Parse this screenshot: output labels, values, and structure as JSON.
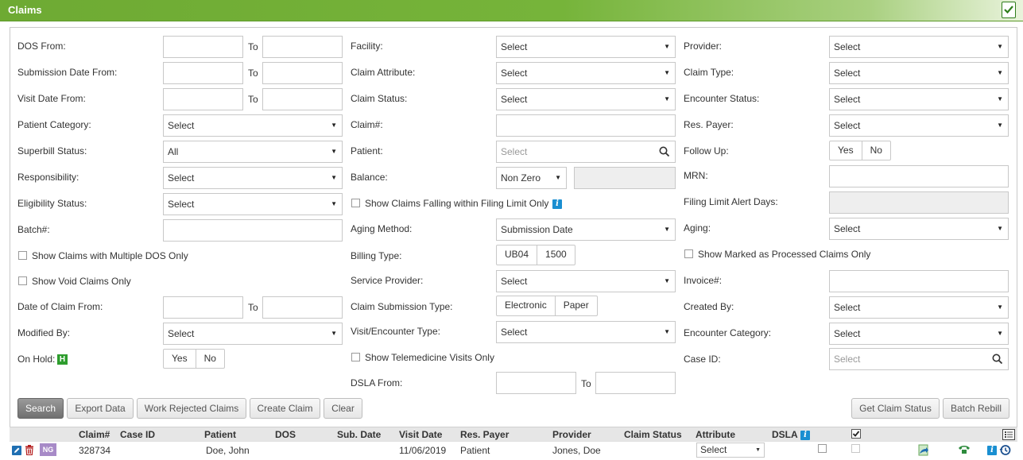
{
  "header": {
    "title": "Claims",
    "icon": "clipboard-check-icon"
  },
  "labels": {
    "dos_from": "DOS From:",
    "to": "To",
    "submission_date_from": "Submission Date From:",
    "visit_date_from": "Visit Date From:",
    "patient_category": "Patient Category:",
    "superbill_status": "Superbill Status:",
    "responsibility": "Responsibility:",
    "eligibility_status": "Eligibility Status:",
    "batch": "Batch#:",
    "show_multiple_dos": "Show Claims with Multiple DOS Only",
    "show_void": "Show Void Claims Only",
    "date_of_claim_from": "Date of Claim From:",
    "modified_by": "Modified By:",
    "on_hold": "On Hold:",
    "facility": "Facility:",
    "claim_attribute": "Claim Attribute:",
    "claim_status": "Claim Status:",
    "claim_no": "Claim#:",
    "patient": "Patient:",
    "balance": "Balance:",
    "show_filing_limit": "Show Claims Falling within Filing Limit Only",
    "aging_method": "Aging Method:",
    "billing_type": "Billing Type:",
    "service_provider": "Service Provider:",
    "claim_submission_type": "Claim Submission Type:",
    "visit_encounter_type": "Visit/Encounter Type:",
    "show_telemedicine": "Show Telemedicine Visits Only",
    "dsla_from": "DSLA From:",
    "provider": "Provider:",
    "claim_type": "Claim Type:",
    "encounter_status": "Encounter Status:",
    "res_payer": "Res. Payer:",
    "follow_up": "Follow Up:",
    "mrn": "MRN:",
    "filing_limit_alert_days": "Filing Limit Alert Days:",
    "aging": "Aging:",
    "show_marked_processed": "Show Marked as Processed Claims Only",
    "invoice": "Invoice#:",
    "created_by": "Created By:",
    "encounter_category": "Encounter Category:",
    "case_id": "Case ID:"
  },
  "values": {
    "select": "Select",
    "superbill_status": "All",
    "patient_placeholder": "Select",
    "balance": "Non Zero",
    "aging_method": "Submission Date",
    "case_id_placeholder": "Select",
    "hold_badge": "H"
  },
  "toggles": {
    "yes": "Yes",
    "no": "No",
    "ub04": "UB04",
    "b1500": "1500",
    "electronic": "Electronic",
    "paper": "Paper"
  },
  "buttons": {
    "search": "Search",
    "export": "Export Data",
    "work_rejected": "Work Rejected Claims",
    "create_claim": "Create Claim",
    "clear": "Clear",
    "get_status": "Get Claim Status",
    "batch_rebill": "Batch Rebill"
  },
  "grid": {
    "columns": [
      "Claim#",
      "Case ID",
      "Patient",
      "DOS",
      "Sub. Date",
      "Visit Date",
      "Res. Payer",
      "Provider",
      "Claim Status",
      "Attribute",
      "DSLA"
    ],
    "rows": [
      {
        "badge": "NG",
        "claim": "328734",
        "case_id": "",
        "patient": "Doe, John",
        "dos": "",
        "sub_date": "",
        "visit_date": "11/06/2019",
        "res_payer": "Patient",
        "provider": "Jones, Doe",
        "claim_status": "",
        "attribute": "Select",
        "dsla": ""
      }
    ]
  }
}
